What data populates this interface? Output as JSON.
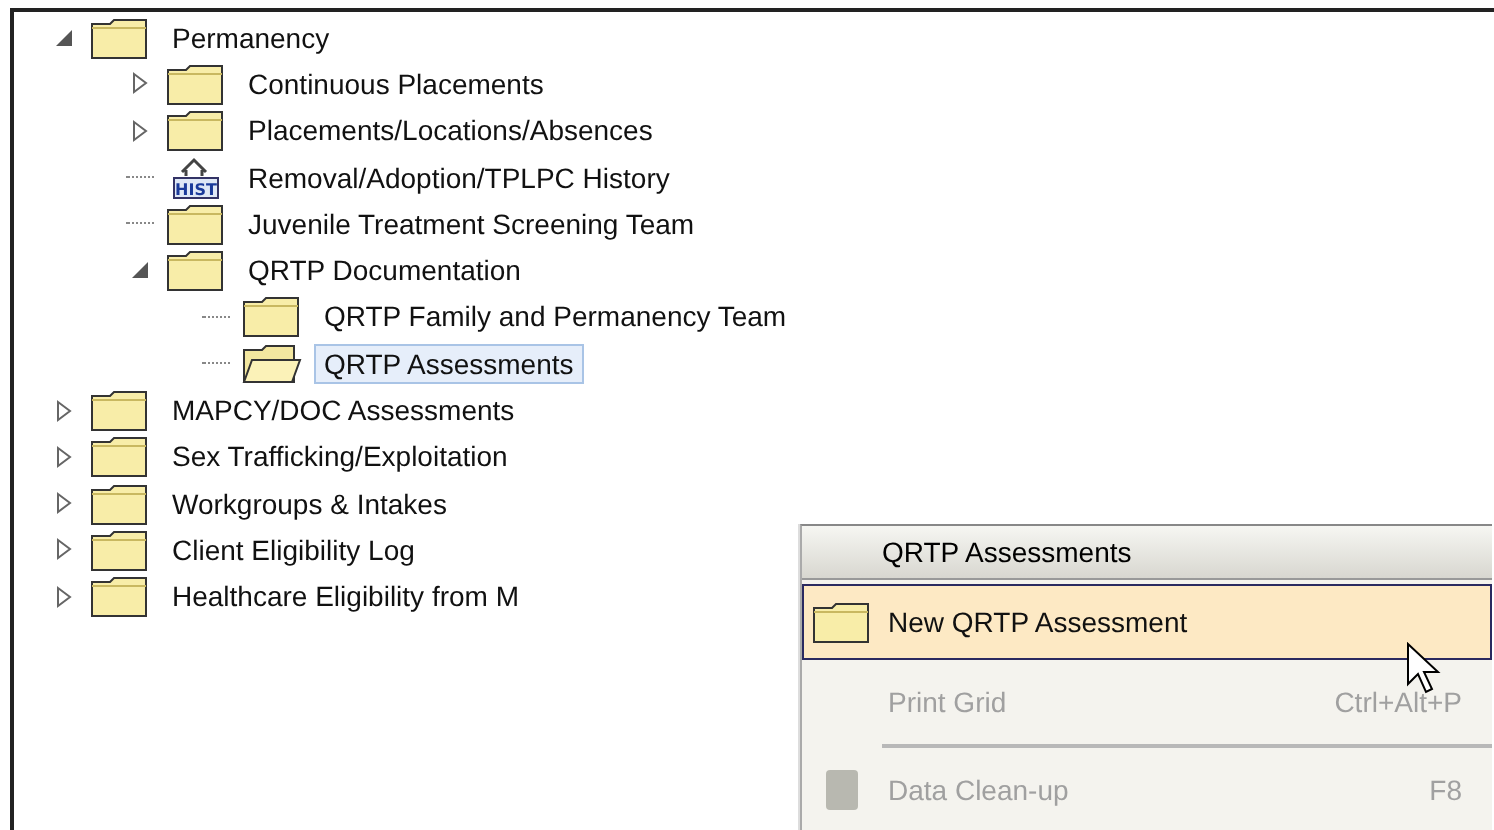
{
  "tree": [
    {
      "label": "Permanency",
      "kind": "folder",
      "expanded": true,
      "selected": false,
      "children": [
        {
          "label": "Continuous Placements",
          "kind": "folder",
          "expanded": false,
          "selected": false
        },
        {
          "label": "Placements/Locations/Absences",
          "kind": "folder",
          "expanded": false,
          "selected": false
        },
        {
          "label": "Removal/Adoption/TPLPC History",
          "kind": "history",
          "badge": "HIST",
          "selected": false
        },
        {
          "label": "Juvenile Treatment Screening Team",
          "kind": "folder",
          "selected": false
        },
        {
          "label": "QRTP Documentation",
          "kind": "folder",
          "expanded": true,
          "selected": false,
          "children": [
            {
              "label": "QRTP Family and Permanency Team",
              "kind": "folder",
              "selected": false
            },
            {
              "label": "QRTP Assessments",
              "kind": "folder",
              "selected": true
            }
          ]
        }
      ]
    },
    {
      "label": "MAPCY/DOC Assessments",
      "kind": "folder",
      "expanded": false,
      "selected": false
    },
    {
      "label": "Sex Trafficking/Exploitation",
      "kind": "folder",
      "expanded": false,
      "selected": false
    },
    {
      "label": "Workgroups & Intakes",
      "kind": "folder",
      "expanded": false,
      "selected": false
    },
    {
      "label": "Client Eligibility Log",
      "kind": "folder",
      "expanded": false,
      "selected": false
    },
    {
      "label": "Healthcare Eligibility from M",
      "kind": "folder",
      "expanded": false,
      "selected": false
    }
  ],
  "context_menu": {
    "title": "QRTP Assessments",
    "items": [
      {
        "label": "New QRTP Assessment",
        "kind": "folder",
        "selected": true,
        "disabled": false
      },
      {
        "label": "Print Grid",
        "kind": "plain",
        "shortcut": "Ctrl+Alt+P",
        "selected": false,
        "disabled": true
      },
      {
        "label": "Data Clean-up",
        "kind": "block",
        "shortcut": "F8",
        "selected": false,
        "disabled": true,
        "separator_before": true
      }
    ]
  }
}
